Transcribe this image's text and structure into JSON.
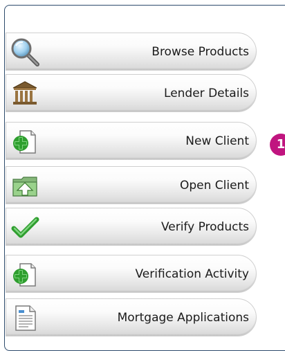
{
  "menu": {
    "items": [
      {
        "label": "Browse Products",
        "icon": "magnifier-icon"
      },
      {
        "label": "Lender Details",
        "icon": "bank-icon"
      },
      {
        "label": "New Client",
        "icon": "new-document-plus-icon"
      },
      {
        "label": "Open Client",
        "icon": "folder-up-arrow-icon"
      },
      {
        "label": "Verify Products",
        "icon": "checkmark-icon"
      },
      {
        "label": "Verification Activity",
        "icon": "document-plus-icon"
      },
      {
        "label": "Mortgage Applications",
        "icon": "document-icon"
      }
    ]
  },
  "callout": {
    "number": "1"
  },
  "colors": {
    "badge": "#c0157f",
    "border": "#2c4a6b"
  }
}
